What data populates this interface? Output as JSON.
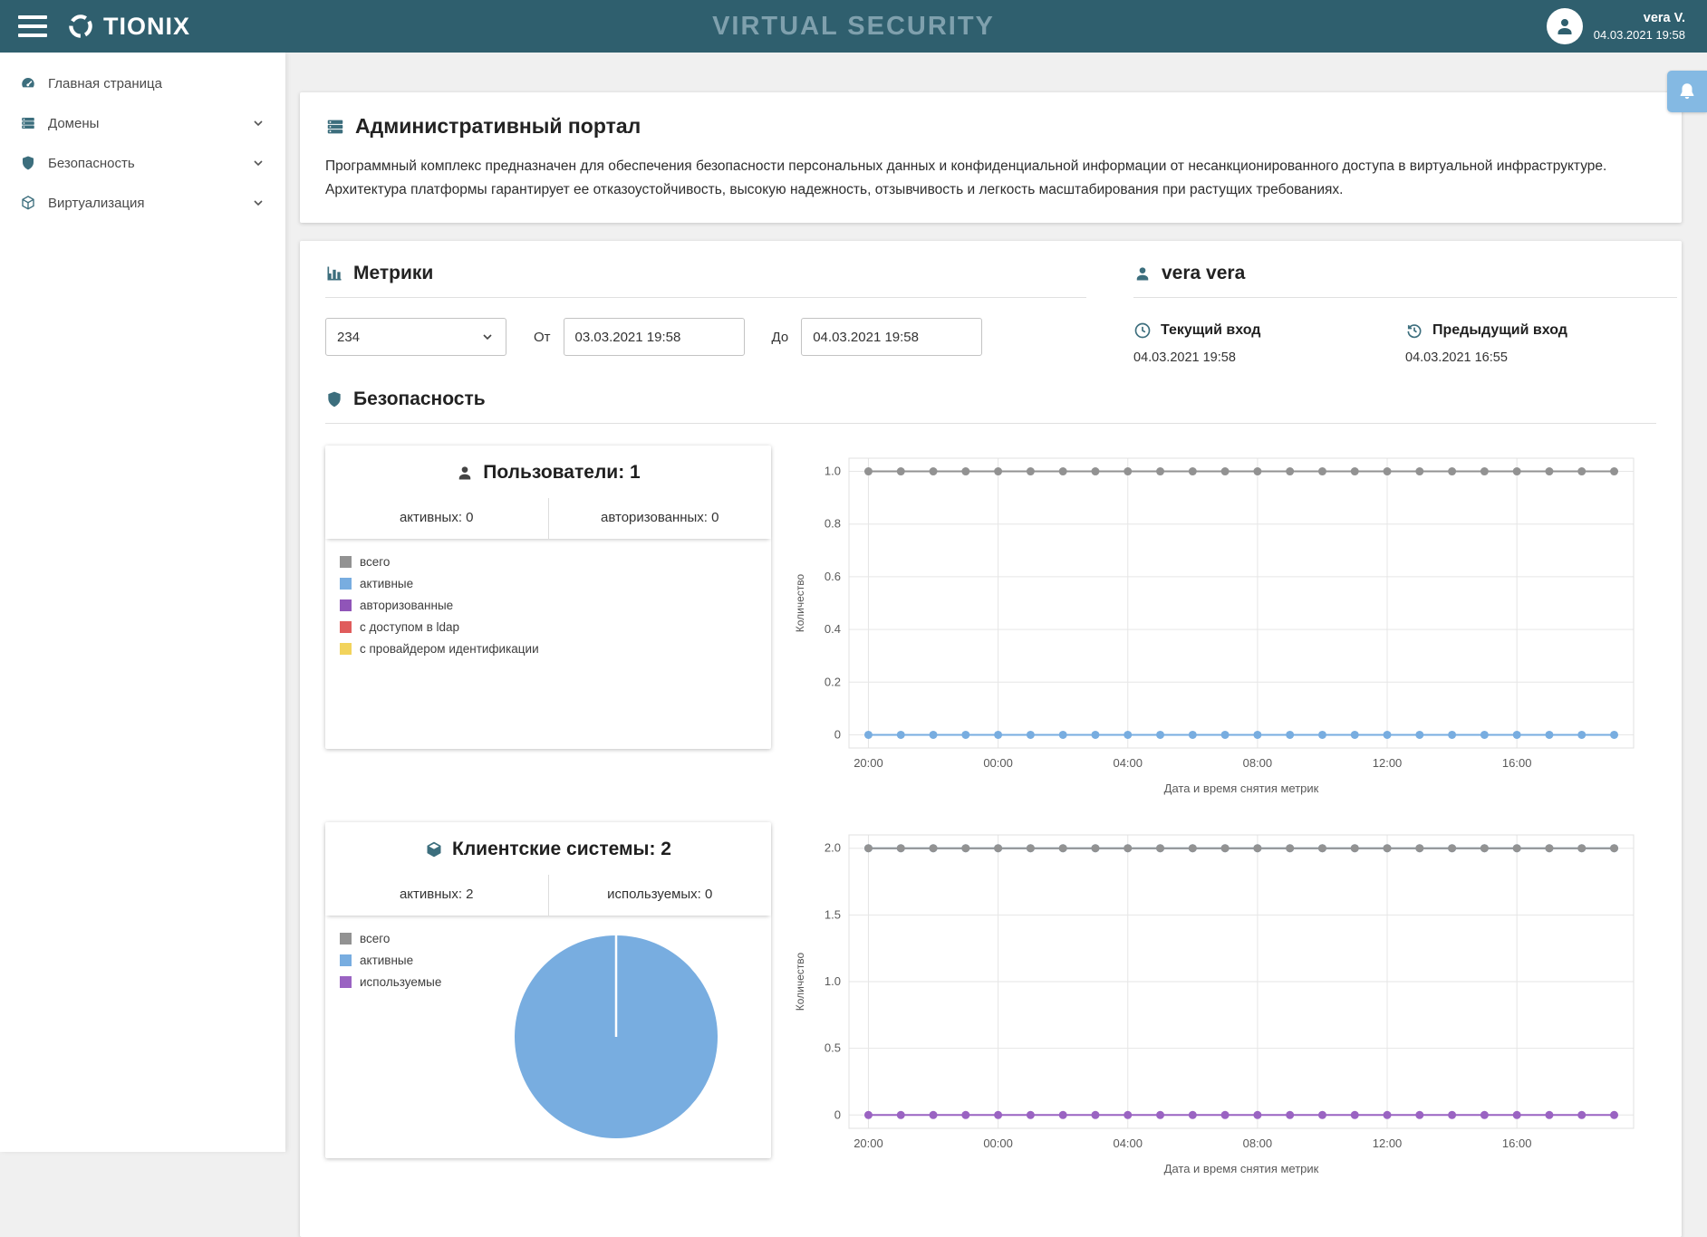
{
  "theme": {
    "header_bg": "#2f5f6e",
    "accent": "#3c6e7d",
    "notification_bg": "#84b9e3",
    "title_color": "#7fa0ad"
  },
  "header": {
    "brand": "TIONIX",
    "title": "VIRTUAL SECURITY",
    "user_name": "vera V.",
    "user_date": "04.03.2021 19:58"
  },
  "sidebar": {
    "items": [
      {
        "label": "Главная страница"
      },
      {
        "label": "Домены"
      },
      {
        "label": "Безопасность"
      },
      {
        "label": "Виртуализация"
      }
    ]
  },
  "portal": {
    "title": "Административный портал",
    "description": "Программный комплекс предназначен для обеспечения безопасности персональных данных и конфиденциальной информации от несанкционированного доступа в виртуальной инфраструктуре. Архитектура платформы гарантирует ее отказоустойчивость, высокую надежность, отзывчивость и легкость масштабирования при растущих требованиях."
  },
  "metrics": {
    "title": "Метрики",
    "select_value": "234",
    "from_label": "От",
    "from_value": "03.03.2021 19:58",
    "to_label": "До",
    "to_value": "04.03.2021 19:58"
  },
  "user_panel": {
    "title": "vera vera",
    "current_login_label": "Текущий вход",
    "current_login_value": "04.03.2021 19:58",
    "previous_login_label": "Предыдущий вход",
    "previous_login_value": "04.03.2021 16:55"
  },
  "security": {
    "title": "Безопасность"
  },
  "users_card": {
    "title": "Пользователи: 1",
    "stat_left": "активных: 0",
    "stat_right": "авторизованных: 0",
    "legend": [
      {
        "label": "всего",
        "color": "#929292"
      },
      {
        "label": "активные",
        "color": "#78ade0"
      },
      {
        "label": "авторизованные",
        "color": "#9055b8"
      },
      {
        "label": "с доступом в ldap",
        "color": "#e05c5c"
      },
      {
        "label": "с провайдером идентификации",
        "color": "#f2d35c"
      }
    ]
  },
  "systems_card": {
    "title": "Клиентские системы: 2",
    "stat_left": "активных: 2",
    "stat_right": "используемых: 0",
    "legend": [
      {
        "label": "всего",
        "color": "#929292"
      },
      {
        "label": "активные",
        "color": "#78ade0"
      },
      {
        "label": "используемые",
        "color": "#9a63c2"
      }
    ]
  },
  "chart_data": [
    {
      "type": "line",
      "name": "users_metrics",
      "ylabel": "Количество",
      "xlabel": "Дата и время снятия метрик",
      "ylim": [
        0,
        1
      ],
      "y_ticks": [
        0,
        0.2,
        0.4,
        0.6,
        0.8,
        1.0
      ],
      "y_tick_labels": [
        "0",
        "0.2",
        "0.4",
        "0.6",
        "0.8",
        "1.0"
      ],
      "x_tick_hours": [
        0,
        4,
        8,
        12,
        16,
        20
      ],
      "x_tick_labels": [
        "20:00",
        "00:00",
        "04:00",
        "08:00",
        "12:00",
        "16:00"
      ],
      "grid": true,
      "legend_position": "none",
      "series": [
        {
          "name": "активные",
          "color": "#78ade0",
          "values": [
            0,
            0,
            0,
            0,
            0,
            0,
            0,
            0,
            0,
            0,
            0,
            0,
            0,
            0,
            0,
            0,
            0,
            0,
            0,
            0,
            0,
            0,
            0,
            0
          ]
        },
        {
          "name": "всего",
          "color": "#929292",
          "values": [
            1,
            1,
            1,
            1,
            1,
            1,
            1,
            1,
            1,
            1,
            1,
            1,
            1,
            1,
            1,
            1,
            1,
            1,
            1,
            1,
            1,
            1,
            1,
            1
          ]
        }
      ]
    },
    {
      "type": "line",
      "name": "client_systems_metrics",
      "ylabel": "Количество",
      "xlabel": "Дата и время снятия метрик",
      "ylim": [
        0,
        2
      ],
      "y_ticks": [
        0,
        0.5,
        1.0,
        1.5,
        2.0
      ],
      "y_tick_labels": [
        "0",
        "0.5",
        "1.0",
        "1.5",
        "2.0"
      ],
      "x_tick_hours": [
        0,
        4,
        8,
        12,
        16,
        20
      ],
      "x_tick_labels": [
        "20:00",
        "00:00",
        "04:00",
        "08:00",
        "12:00",
        "16:00"
      ],
      "grid": true,
      "legend_position": "none",
      "series": [
        {
          "name": "активные",
          "color": "#78ade0",
          "values": [
            2,
            2,
            2,
            2,
            2,
            2,
            2,
            2,
            2,
            2,
            2,
            2,
            2,
            2,
            2,
            2,
            2,
            2,
            2,
            2,
            2,
            2,
            2,
            2
          ]
        },
        {
          "name": "всего",
          "color": "#929292",
          "values": [
            2,
            2,
            2,
            2,
            2,
            2,
            2,
            2,
            2,
            2,
            2,
            2,
            2,
            2,
            2,
            2,
            2,
            2,
            2,
            2,
            2,
            2,
            2,
            2
          ]
        },
        {
          "name": "используемые",
          "color": "#9a63c2",
          "values": [
            0,
            0,
            0,
            0,
            0,
            0,
            0,
            0,
            0,
            0,
            0,
            0,
            0,
            0,
            0,
            0,
            0,
            0,
            0,
            0,
            0,
            0,
            0,
            0
          ]
        }
      ]
    },
    {
      "type": "pie",
      "name": "client_systems_pie",
      "slices": [
        {
          "label": "активные",
          "value": 2,
          "color": "#78ade0"
        }
      ]
    }
  ]
}
